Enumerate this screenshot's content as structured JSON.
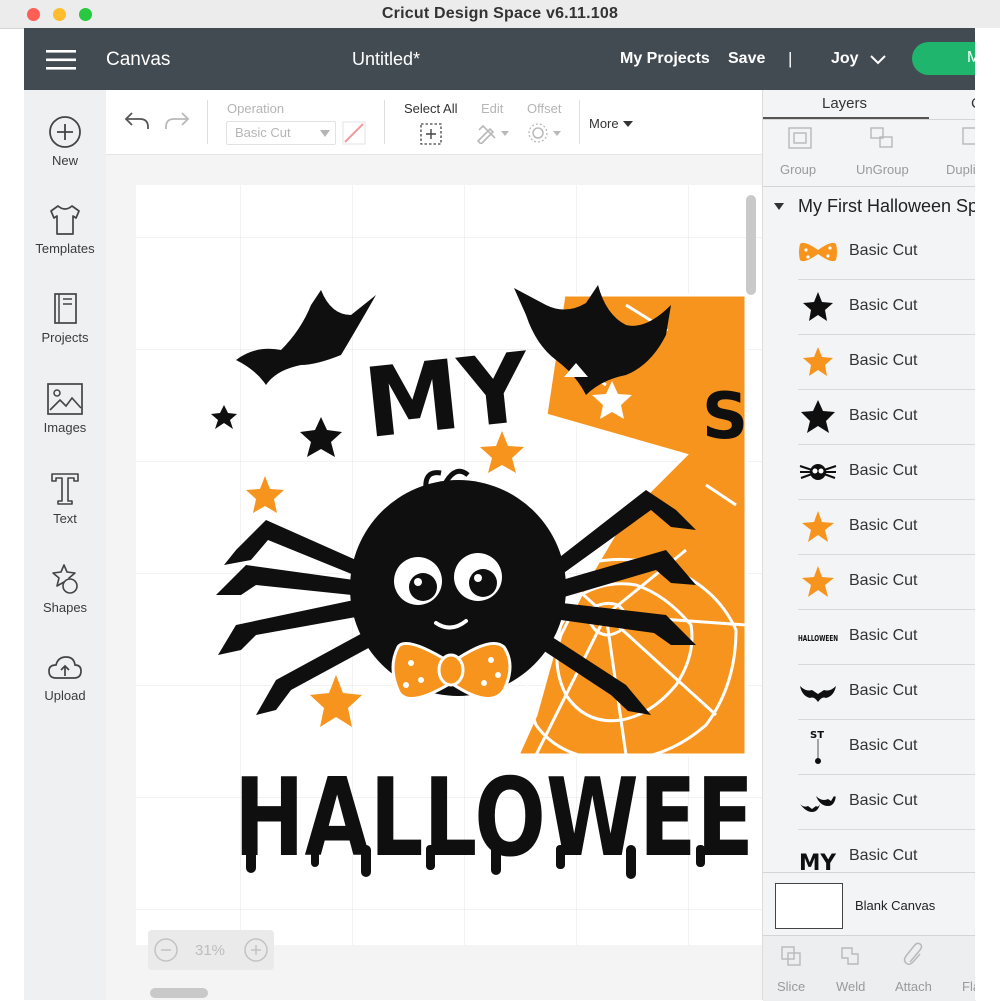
{
  "window": {
    "title": "Cricut Design Space  v6.11.108"
  },
  "header": {
    "canvas_label": "Canvas",
    "doc_title": "Untitled*",
    "my_projects": "My Projects",
    "save": "Save",
    "divider": "|",
    "user": "Joy",
    "make_button_partial": "M"
  },
  "sidebar": {
    "items": [
      {
        "label": "New",
        "icon": "plus-circle-icon"
      },
      {
        "label": "Templates",
        "icon": "tshirt-icon"
      },
      {
        "label": "Projects",
        "icon": "book-icon"
      },
      {
        "label": "Images",
        "icon": "image-icon"
      },
      {
        "label": "Text",
        "icon": "text-icon"
      },
      {
        "label": "Shapes",
        "icon": "shapes-icon"
      },
      {
        "label": "Upload",
        "icon": "upload-cloud-icon"
      }
    ]
  },
  "toolbar": {
    "operation_label": "Operation",
    "operation_value": "Basic Cut",
    "select_all": "Select All",
    "edit": "Edit",
    "offset": "Offset",
    "more": "More"
  },
  "zoom": {
    "value": "31%"
  },
  "artwork": {
    "text_my": "MY",
    "text_halloween": "HALLOWEE",
    "text_s": "S",
    "colors": {
      "black": "#0f0f0f",
      "orange": "#f7941d"
    }
  },
  "panel": {
    "tab_layers": "Layers",
    "tab_partial": "C",
    "actions": [
      "Group",
      "UnGroup",
      "Dupli"
    ],
    "group_title": "My First Halloween Sp",
    "layers": [
      {
        "name": "Basic Cut",
        "thumb": "orange-bow"
      },
      {
        "name": "Basic Cut",
        "thumb": "black-star"
      },
      {
        "name": "Basic Cut",
        "thumb": "orange-star"
      },
      {
        "name": "Basic Cut",
        "thumb": "black-star"
      },
      {
        "name": "Basic Cut",
        "thumb": "spider"
      },
      {
        "name": "Basic Cut",
        "thumb": "orange-star"
      },
      {
        "name": "Basic Cut",
        "thumb": "orange-star"
      },
      {
        "name": "Basic Cut",
        "thumb": "halloween-text",
        "thumb_text": "HALLOWEEN"
      },
      {
        "name": "Basic Cut",
        "thumb": "bat"
      },
      {
        "name": "Basic Cut",
        "thumb": "st-hanging",
        "thumb_text": "ST"
      },
      {
        "name": "Basic Cut",
        "thumb": "bats"
      },
      {
        "name": "Basic Cut",
        "thumb": "my-text",
        "thumb_text": "MY"
      }
    ],
    "blank_canvas": "Blank Canvas",
    "bottom_actions": [
      "Slice",
      "Weld",
      "Attach",
      "Fla"
    ]
  }
}
